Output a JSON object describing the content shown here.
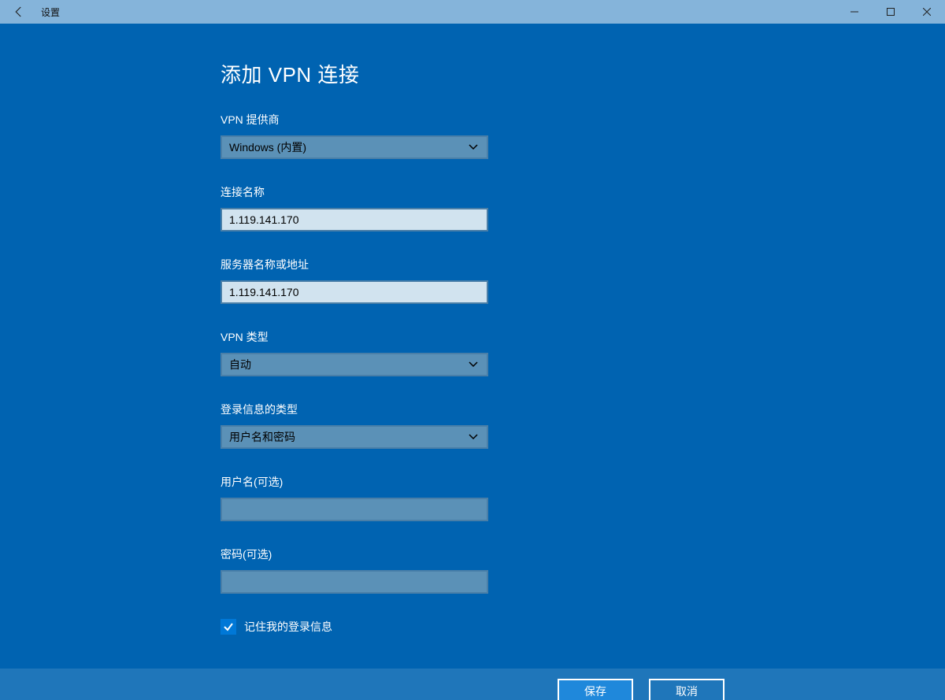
{
  "titlebar": {
    "title": "设置"
  },
  "page": {
    "heading": "添加 VPN 连接"
  },
  "fields": {
    "provider": {
      "label": "VPN 提供商",
      "value": "Windows (内置)"
    },
    "connection_name": {
      "label": "连接名称",
      "value": "1.119.141.170"
    },
    "server": {
      "label": "服务器名称或地址",
      "value": "1.119.141.170"
    },
    "vpn_type": {
      "label": "VPN 类型",
      "value": "自动"
    },
    "signin_type": {
      "label": "登录信息的类型",
      "value": "用户名和密码"
    },
    "username": {
      "label": "用户名(可选)",
      "value": ""
    },
    "password": {
      "label": "密码(可选)",
      "value": ""
    }
  },
  "remember": {
    "label": "记住我的登录信息",
    "checked": true
  },
  "actions": {
    "save": "保存",
    "cancel": "取消"
  }
}
